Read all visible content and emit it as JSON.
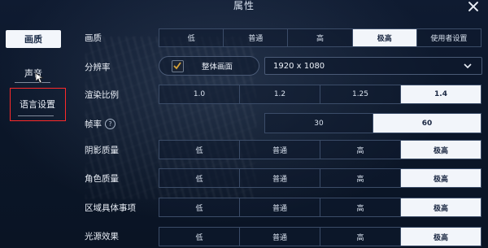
{
  "window": {
    "title": "属性"
  },
  "sidebar": {
    "items": [
      {
        "label": "画质",
        "active": true
      },
      {
        "label": "声音",
        "active": false
      },
      {
        "label": "语言设置",
        "active": false
      }
    ]
  },
  "settings": {
    "quality": {
      "label": "画质",
      "options": [
        "低",
        "普通",
        "高",
        "极高",
        "使用者设置"
      ],
      "selected": "极高"
    },
    "resolution": {
      "label": "分辨率",
      "fullscreen_label": "整体画面",
      "fullscreen_checked": true,
      "value": "1920 x 1080"
    },
    "render_scale": {
      "label": "渲染比例",
      "options": [
        "1.0",
        "1.2",
        "1.25",
        "1.4"
      ],
      "selected": "1.4"
    },
    "frame_rate": {
      "label": "帧率",
      "help": "?",
      "options": [
        "30",
        "60"
      ],
      "selected": "60"
    },
    "shadow_quality": {
      "label": "阴影质量",
      "options": [
        "低",
        "普通",
        "高",
        "极高"
      ],
      "selected": "极高"
    },
    "character_quality": {
      "label": "角色质量",
      "options": [
        "低",
        "普通",
        "高",
        "极高"
      ],
      "selected": "极高"
    },
    "area_detail": {
      "label": "区域具体事项",
      "options": [
        "低",
        "普通",
        "高",
        "极高"
      ],
      "selected": "极高"
    },
    "light_effects": {
      "label": "光源效果",
      "options": [
        "低",
        "普通",
        "高",
        "极高"
      ],
      "selected": "极高"
    }
  },
  "colors": {
    "background": "#0a1426",
    "selected_option": "#f2f5fa",
    "highlight_box": "#ff2a2a"
  }
}
